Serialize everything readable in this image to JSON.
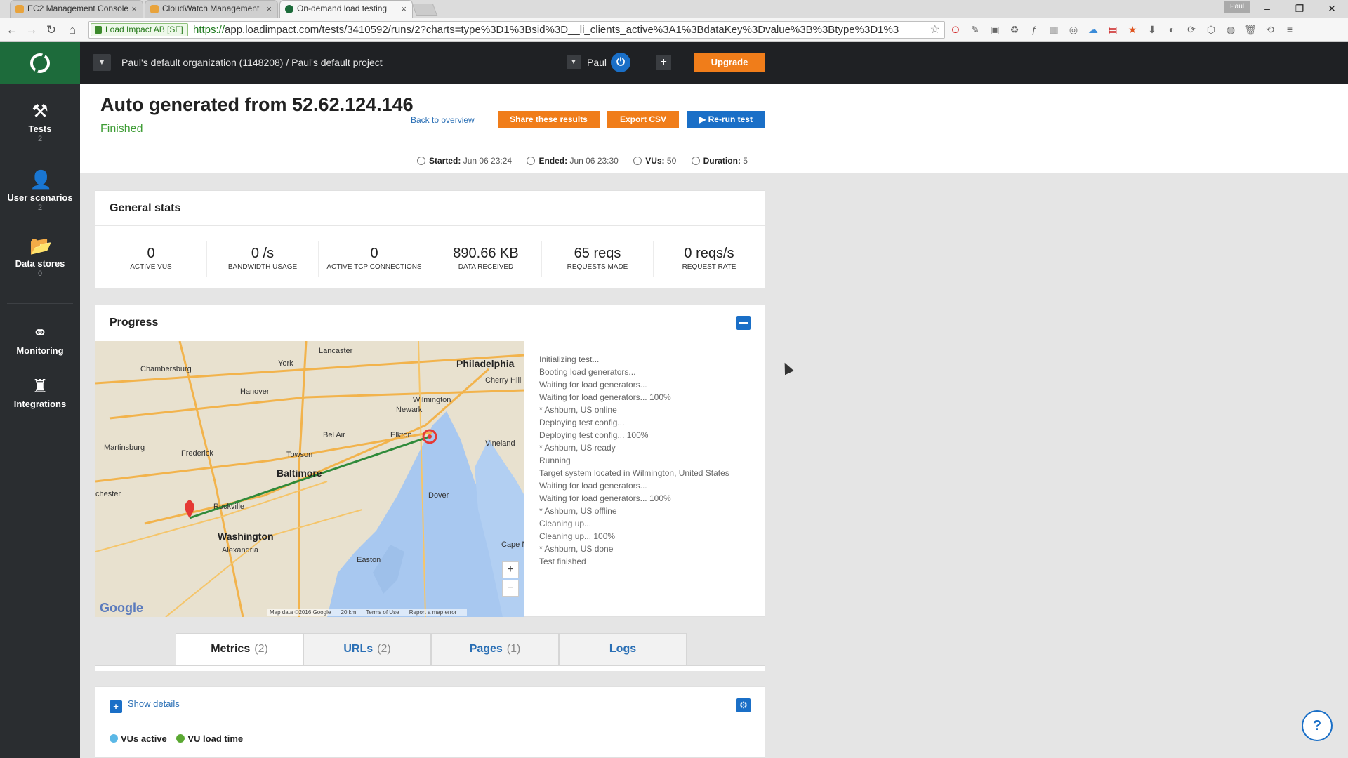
{
  "browser": {
    "tabs": [
      {
        "label": "EC2 Management Console",
        "active": false
      },
      {
        "label": "CloudWatch Management",
        "active": false
      },
      {
        "label": "On-demand load testing",
        "active": true
      }
    ],
    "user_chip": "Paul",
    "secure_label": "Load Impact AB [SE]",
    "url_scheme": "https://",
    "url_rest": "app.loadimpact.com/tests/3410592/runs/2?charts=type%3D1%3Bsid%3D__li_clients_active%3A1%3BdataKey%3Dvalue%3B%3Btype%3D1%3"
  },
  "sidebar": {
    "items": [
      {
        "label": "Tests",
        "count": "2",
        "icon": "tools-icon"
      },
      {
        "label": "User scenarios",
        "count": "2",
        "icon": "user-icon"
      },
      {
        "label": "Data stores",
        "count": "0",
        "icon": "folder-icon"
      },
      {
        "label": "Monitoring",
        "count": "",
        "icon": "binoculars-icon"
      },
      {
        "label": "Integrations",
        "count": "",
        "icon": "puzzle-icon"
      }
    ]
  },
  "topbar": {
    "org": "Paul's default organization (1148208) / Paul's default project",
    "user": "Paul",
    "upgrade": "Upgrade"
  },
  "header": {
    "title": "Auto generated from 52.62.124.146",
    "status": "Finished",
    "back": "Back to overview",
    "share": "Share these results",
    "export": "Export CSV",
    "rerun": "▶ Re-run test",
    "started_label": "Started:",
    "started": "Jun 06 23:24",
    "ended_label": "Ended:",
    "ended": "Jun 06 23:30",
    "vus_label": "VUs:",
    "vus": "50",
    "duration_label": "Duration:",
    "duration": "5"
  },
  "general_stats": {
    "title": "General stats",
    "stats": [
      {
        "value": "0",
        "label": "Active VUs"
      },
      {
        "value": "0 /s",
        "label": "Bandwidth usage"
      },
      {
        "value": "0",
        "label": "Active TCP connections"
      },
      {
        "value": "890.66 KB",
        "label": "Data received"
      },
      {
        "value": "65 reqs",
        "label": "Requests made"
      },
      {
        "value": "0 reqs/s",
        "label": "Request rate"
      }
    ]
  },
  "progress": {
    "title": "Progress",
    "map_labels": {
      "lancaster": "Lancaster",
      "philadelphia": "Philadelphia",
      "cherry_hill": "Cherry Hill",
      "chambersburg": "Chambersburg",
      "york": "York",
      "hanover": "Hanover",
      "wilmington": "Wilmington",
      "newark": "Newark",
      "elkton": "Elkton",
      "bel_air": "Bel Air",
      "vineland": "Vineland",
      "frederick": "Frederick",
      "towson": "Towson",
      "baltimore": "Baltimore",
      "martinsburg": "Martinsburg",
      "dover": "Dover",
      "rockville": "Rockville",
      "chester": "chester",
      "washington": "Washington",
      "alexandria": "Alexandria",
      "easton": "Easton",
      "cape_m": "Cape M"
    },
    "map_zoom_in": "+",
    "map_zoom_out": "−",
    "map_logo": "Google",
    "map_attrib": [
      "Map data ©2016 Google",
      "20 km",
      "Terms of Use",
      "Report a map error"
    ],
    "log": [
      "Initializing test...",
      "Booting load generators...",
      "Waiting for load generators...",
      "Waiting for load generators... 100%",
      "* Ashburn, US online",
      "Deploying test config...",
      "Deploying test config... 100%",
      "* Ashburn, US ready",
      "Running",
      "Target system located in Wilmington, United States",
      "Waiting for load generators...",
      "Waiting for load generators... 100%",
      "* Ashburn, US offline",
      "Cleaning up...",
      "Cleaning up... 100%",
      "* Ashburn, US done",
      "Test finished"
    ]
  },
  "tabs": [
    {
      "label": "Metrics",
      "count": "(2)",
      "active": true
    },
    {
      "label": "URLs",
      "count": "(2)",
      "active": false
    },
    {
      "label": "Pages",
      "count": "(1)",
      "active": false
    },
    {
      "label": "Logs",
      "count": "",
      "active": false
    }
  ],
  "details": {
    "show": "Show details",
    "legend": [
      {
        "label": "VUs active",
        "color": "#5bb8e6"
      },
      {
        "label": "VU load time",
        "color": "#5aa832"
      }
    ]
  },
  "help": "?",
  "colors": {
    "accent_orange": "#f07d1a",
    "accent_blue": "#1a6fc7",
    "brand_green": "#1d6b3b"
  }
}
